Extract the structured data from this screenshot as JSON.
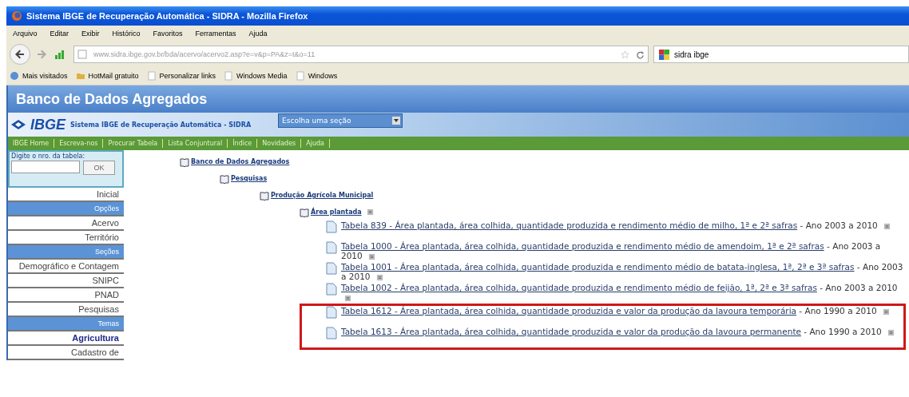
{
  "window": {
    "title": "Sistema IBGE de Recuperação Automática - SIDRA - Mozilla Firefox"
  },
  "menu": [
    "Arquivo",
    "Editar",
    "Exibir",
    "Histórico",
    "Favoritos",
    "Ferramentas",
    "Ajuda"
  ],
  "address": {
    "value": "www.sidra.ibge.gov.br/bda/acervo/acervo2.asp?e=v&p=PA&z=t&o=11"
  },
  "search": {
    "value": "sidra ibge"
  },
  "bookmarks": [
    {
      "label": "Mais visitados",
      "kind": "globe"
    },
    {
      "label": "HotMail gratuito",
      "kind": "folder"
    },
    {
      "label": "Personalizar links",
      "kind": "page"
    },
    {
      "label": "Windows Media",
      "kind": "page"
    },
    {
      "label": "Windows",
      "kind": "page"
    }
  ],
  "page": {
    "banner": "Banco de Dados Agregados",
    "logo": "IBGE",
    "system_title": "Sistema IBGE de Recuperação Automática - SIDRA",
    "section_select": "Escolha uma seção",
    "nav": [
      "IBGE Home",
      "Escreva-nos",
      "Procurar Tabela",
      "Lista Conjuntural",
      "Índice",
      "Novidades",
      "Ajuda"
    ],
    "table_lookup": {
      "label": "Digite o nro. da tabela:",
      "button": "OK"
    },
    "sidebar": [
      {
        "label": "Inicial",
        "kind": "item"
      },
      {
        "label": "Opções",
        "kind": "header"
      },
      {
        "label": "Acervo",
        "kind": "item"
      },
      {
        "label": "Território",
        "kind": "item"
      },
      {
        "label": "Seções",
        "kind": "header"
      },
      {
        "label": "Demográfico e Contagem",
        "kind": "item"
      },
      {
        "label": "SNIPC",
        "kind": "item"
      },
      {
        "label": "PNAD",
        "kind": "item"
      },
      {
        "label": "Pesquisas",
        "kind": "item"
      },
      {
        "label": "Temas",
        "kind": "header"
      },
      {
        "label": "Agricultura",
        "kind": "current"
      },
      {
        "label": "Cadastro de",
        "kind": "item"
      }
    ],
    "tree": [
      {
        "label": "Banco de Dados Agregados",
        "children": [
          {
            "label": "Pesquisas",
            "children": [
              {
                "label": "Produção Agrícola Municipal",
                "children": [
                  {
                    "label": "Área plantada",
                    "note_icon": true,
                    "tables": [
                      {
                        "link": "Tabela 839 - Área plantada, área colhida, quantidade produzida e rendimento médio de milho, 1ª e 2ª safras",
                        "period": "- Ano 2003 a 2010",
                        "highlighted": false
                      },
                      {
                        "link": "Tabela 1000 - Área plantada, área colhida, quantidade produzida e rendimento médio de amendoim, 1ª e 2ª safras",
                        "period": "- Ano 2003 a 2010",
                        "highlighted": false
                      },
                      {
                        "link": "Tabela 1001 - Área plantada, área colhida, quantidade produzida e rendimento médio de batata-inglesa, 1ª, 2ª e 3ª safras",
                        "period": "- Ano 2003 a 2010",
                        "highlighted": false
                      },
                      {
                        "link": "Tabela 1002 - Área plantada, área colhida, quantidade produzida e rendimento médio de feijão, 1ª, 2ª e 3ª safras",
                        "period": "- Ano 2003 a 2010",
                        "highlighted": false
                      },
                      {
                        "link": "Tabela 1612 - Área plantada, área colhida, quantidade produzida e valor da produção da lavoura temporária",
                        "period": "- Ano 1990 a 2010",
                        "highlighted": true
                      },
                      {
                        "link": "Tabela 1613 - Área plantada, área colhida, quantidade produzida e valor da produção da lavoura permanente",
                        "period": "- Ano 1990 a 2010",
                        "highlighted": true
                      }
                    ]
                  }
                ]
              }
            ]
          }
        ]
      }
    ]
  }
}
